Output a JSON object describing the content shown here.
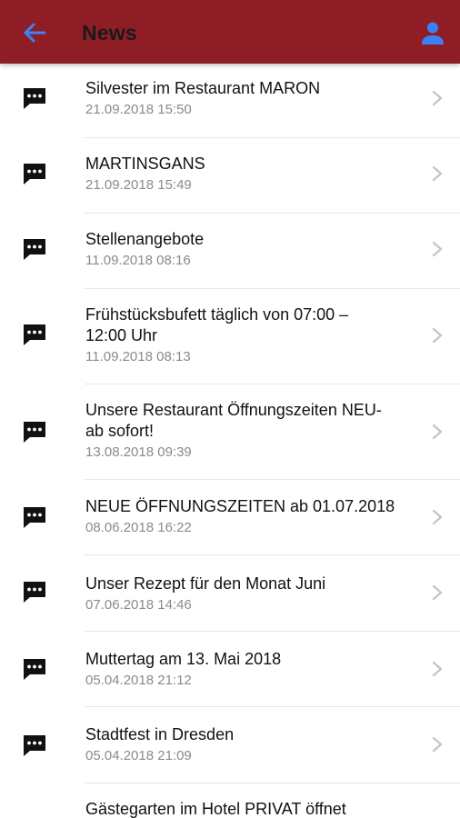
{
  "header": {
    "title": "News",
    "back_icon": "arrow-left-icon",
    "profile_icon": "person-icon",
    "bar_color": "#8f1d26",
    "icon_color": "#3b82f6"
  },
  "news": [
    {
      "title": "Silvester im Restaurant MARON",
      "date": "21.09.2018 15:50"
    },
    {
      "title": "MARTINSGANS",
      "date": "21.09.2018 15:49"
    },
    {
      "title": "Stellenangebote",
      "date": "11.09.2018 08:16"
    },
    {
      "title": "Frühstücksbufett täglich von 07:00 –\n12:00 Uhr",
      "date": "11.09.2018 08:13"
    },
    {
      "title": "Unsere Restaurant Öffnungszeiten NEU-\nab sofort!",
      "date": "13.08.2018 09:39"
    },
    {
      "title": "NEUE ÖFFNUNGSZEITEN ab 01.07.2018",
      "date": "08.06.2018 16:22"
    },
    {
      "title": "Unser Rezept für den Monat Juni",
      "date": "07.06.2018 14:46"
    },
    {
      "title": "Muttertag am 13. Mai 2018",
      "date": "05.04.2018 21:12"
    },
    {
      "title": "Stadtfest in Dresden",
      "date": "05.04.2018 21:09"
    },
    {
      "title": "Gästegarten im Hotel PRIVAT öffnet",
      "date": ""
    }
  ]
}
